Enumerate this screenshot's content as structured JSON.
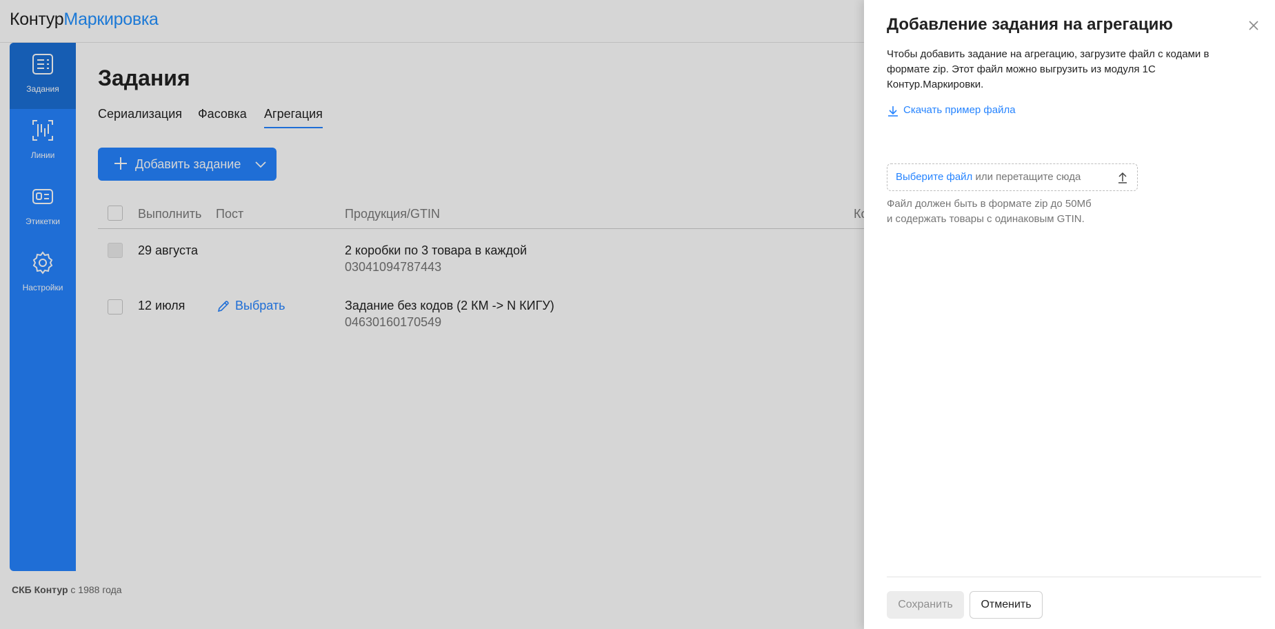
{
  "brand": {
    "part1": "Контур",
    "part2": "Маркировка"
  },
  "sidebar": {
    "items": [
      {
        "label": "Задания",
        "icon": "tasks-icon",
        "active": true
      },
      {
        "label": "Линии",
        "icon": "lines-icon",
        "active": false
      },
      {
        "label": "Этикетки",
        "icon": "labels-icon",
        "active": false
      },
      {
        "label": "Настройки",
        "icon": "gear-icon",
        "active": false
      }
    ]
  },
  "main": {
    "title": "Задания",
    "tabs": [
      {
        "label": "Сериализация",
        "active": false
      },
      {
        "label": "Фасовка",
        "active": false
      },
      {
        "label": "Агрегация",
        "active": true
      }
    ],
    "add_button": "Добавить задание",
    "table": {
      "columns": [
        "Выполнить",
        "Пост",
        "Продукция/GTIN",
        "Ко"
      ],
      "rows": [
        {
          "date": "29 августа",
          "post": "",
          "product": "2 коробки по 3 товара в каждой",
          "gtin": "03041094787443"
        },
        {
          "date": "12 июля",
          "post": "Выбрать",
          "product": "Задание без кодов (2 КМ -> N КИГУ)",
          "gtin": "04630160170549"
        }
      ]
    }
  },
  "footer": {
    "company": "СКБ Контур",
    "since": "с 1988 года"
  },
  "panel": {
    "title": "Добавление задания на агрегацию",
    "description": "Чтобы добавить задание на агрегацию, загрузите файл с кодами в формате zip. Этот файл можно выгрузить из модуля 1С Контур.Маркировки.",
    "download_link": "Скачать пример файла",
    "dropzone": {
      "link": "Выберите файл",
      "rest": "или перетащите сюда"
    },
    "hint_line1": "Файл должен быть в формате zip до 50Мб",
    "hint_line2": "и содержать товары с одинаковым GTIN.",
    "save_label": "Сохранить",
    "cancel_label": "Отменить"
  },
  "colors": {
    "accent": "#2684ff",
    "sidebar_active": "#1b6fd6",
    "link": "#2684ff"
  }
}
